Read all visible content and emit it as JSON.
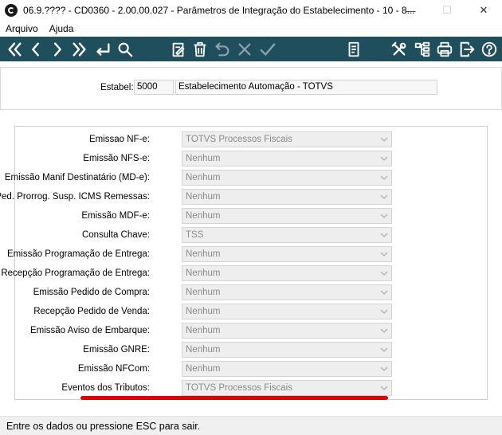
{
  "window": {
    "title": "06.9.???? - CD0360 - 2.00.00.027 - Parâmetros de Integração do Estabelecimento - 10 - 8...",
    "minimize_glyph": "—",
    "maximize_glyph": "☐",
    "close_glyph": "✕"
  },
  "menu": {
    "items": [
      "Arquivo",
      "Ajuda"
    ]
  },
  "toolbar": {
    "color": "#1f4e5c",
    "icons": [
      "first-icon",
      "previous-icon",
      "next-icon",
      "last-icon",
      "goto-icon",
      "search-icon",
      "edit-icon",
      "delete-icon",
      "undo-icon",
      "cancel-icon",
      "confirm-icon",
      "report-icon",
      "tools-icon",
      "hierarchy-icon",
      "print-icon",
      "exit-icon",
      "help-icon"
    ]
  },
  "header": {
    "estab_label": "Estabel:",
    "estab_code": "5000",
    "estab_name": "Estabelecimento Automação - TOTVS"
  },
  "form": {
    "rows": [
      {
        "label": "Emissao NF-e:",
        "value": "TOTVS Processos Fiscais"
      },
      {
        "label": "Emissão NFS-e:",
        "value": "Nenhum"
      },
      {
        "label": "Emissão Manif Destinatário (MD-e):",
        "value": "Nenhum"
      },
      {
        "label": "Ped. Prorrog. Susp. ICMS Remessas:",
        "value": "Nenhum"
      },
      {
        "label": "Emissão MDF-e:",
        "value": "Nenhum"
      },
      {
        "label": "Consulta Chave:",
        "value": "TSS"
      },
      {
        "label": "Emissão Programação de Entrega:",
        "value": "Nenhum"
      },
      {
        "label": "Recepção Programação de Entrega:",
        "value": "Nenhum"
      },
      {
        "label": "Emissão Pedido de Compra:",
        "value": "Nenhum"
      },
      {
        "label": "Recepção Pedido de Venda:",
        "value": "Nenhum"
      },
      {
        "label": "Emissão Aviso de Embarque:",
        "value": "Nenhum"
      },
      {
        "label": "Emissão GNRE:",
        "value": "Nenhum"
      },
      {
        "label": "Emissão NFCom:",
        "value": "Nenhum"
      },
      {
        "label": "Eventos dos Tributos:",
        "value": "TOTVS Processos Fiscais"
      }
    ]
  },
  "annotation": {
    "highlight_color": "#e00000"
  },
  "status": {
    "text": "Entre os dados ou pressione ESC para sair."
  }
}
